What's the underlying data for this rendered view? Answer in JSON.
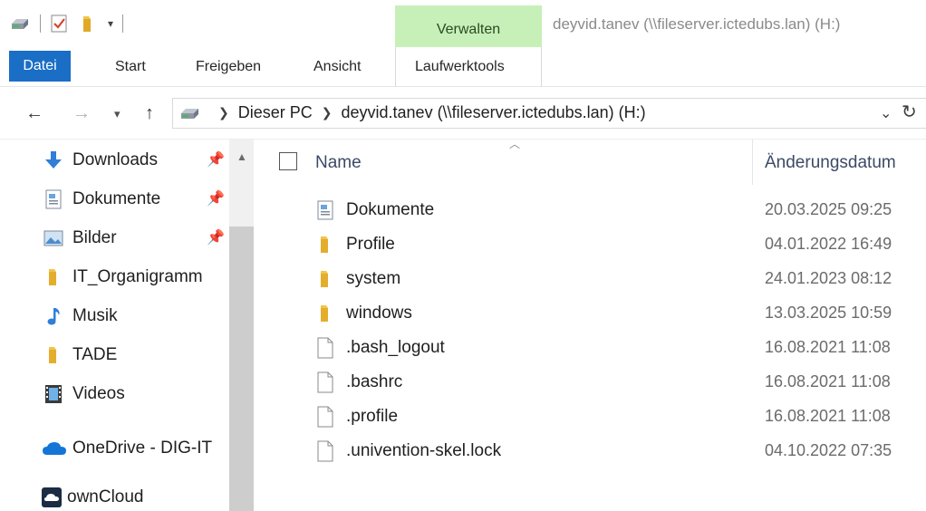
{
  "titlebar": {
    "manage_tab": "Verwalten",
    "window_title": "deyvid.tanev (\\\\fileserver.ictedubs.lan) (H:)"
  },
  "ribbon": {
    "tabs": [
      "Datei",
      "Start",
      "Freigeben",
      "Ansicht",
      "Laufwerktools"
    ]
  },
  "address": {
    "crumbs": [
      "Dieser PC",
      "deyvid.tanev (\\\\fileserver.ictedubs.lan) (H:)"
    ]
  },
  "nav": {
    "items": [
      {
        "label": "Downloads",
        "icon": "download-arrow-icon",
        "pinned": true
      },
      {
        "label": "Dokumente",
        "icon": "document-icon",
        "pinned": true
      },
      {
        "label": "Bilder",
        "icon": "pictures-icon",
        "pinned": true
      },
      {
        "label": "IT_Organigramm",
        "icon": "folder-icon",
        "pinned": false
      },
      {
        "label": "Musik",
        "icon": "music-note-icon",
        "pinned": false
      },
      {
        "label": "TADE",
        "icon": "folder-icon",
        "pinned": false
      },
      {
        "label": "Videos",
        "icon": "video-icon",
        "pinned": false
      },
      {
        "label": "OneDrive - DIG-IT",
        "icon": "onedrive-cloud-icon",
        "pinned": false
      },
      {
        "label": "ownCloud",
        "icon": "owncloud-icon",
        "pinned": false
      }
    ]
  },
  "filelist": {
    "columns": {
      "name": "Name",
      "date": "Änderungsdatum"
    },
    "rows": [
      {
        "name": "Dokumente",
        "date": "20.03.2025 09:25",
        "icon": "document-folder-icon"
      },
      {
        "name": "Profile",
        "date": "04.01.2022 16:49",
        "icon": "folder-icon"
      },
      {
        "name": "system",
        "date": "24.01.2023 08:12",
        "icon": "folder-icon"
      },
      {
        "name": "windows",
        "date": "13.03.2025 10:59",
        "icon": "folder-icon"
      },
      {
        "name": ".bash_logout",
        "date": "16.08.2021 11:08",
        "icon": "file-icon"
      },
      {
        "name": ".bashrc",
        "date": "16.08.2021 11:08",
        "icon": "file-icon"
      },
      {
        "name": ".profile",
        "date": "16.08.2021 11:08",
        "icon": "file-icon"
      },
      {
        "name": ".univention-skel.lock",
        "date": "04.10.2022 07:35",
        "icon": "file-icon"
      }
    ]
  },
  "colors": {
    "accent": "#1a6ec5",
    "manage_tab_bg": "#c7f0b9",
    "folder": "#f3c44a"
  }
}
